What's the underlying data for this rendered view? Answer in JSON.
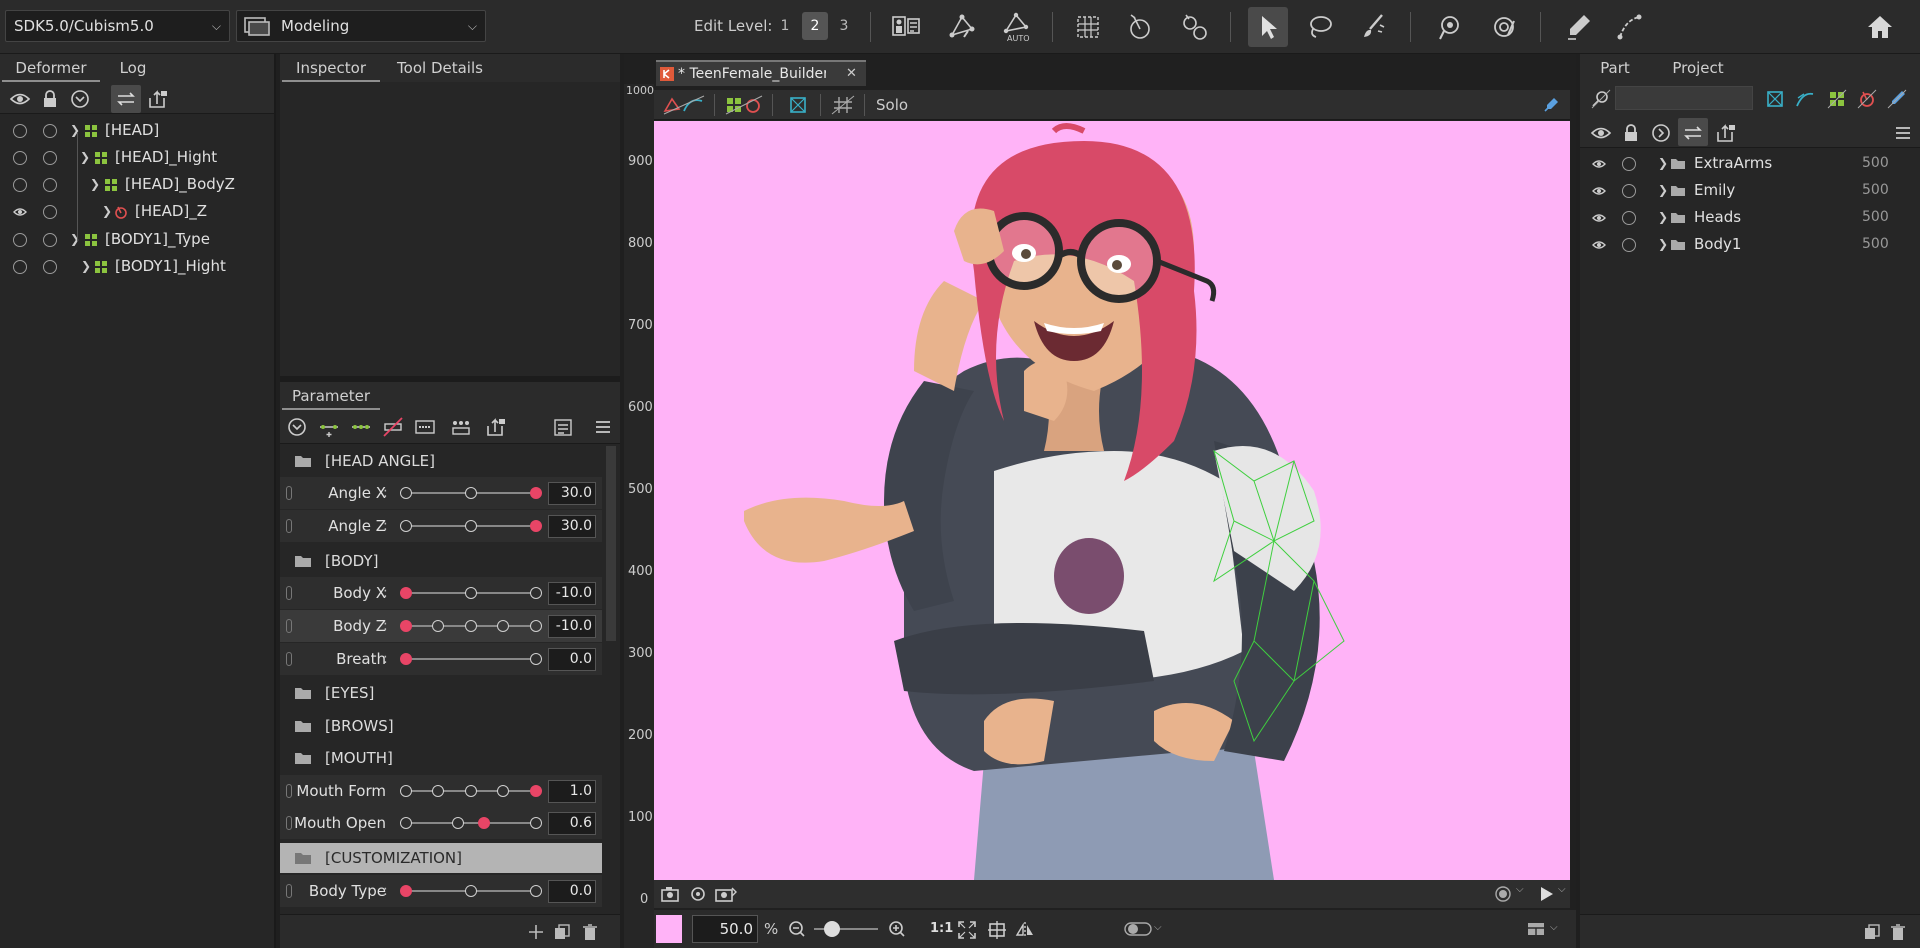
{
  "toolbar": {
    "sdk_select": "SDK5.0/Cubism5.0",
    "mode_select": "Modeling",
    "edit_level_label": "Edit Level:",
    "edit_levels": [
      "1",
      "2",
      "3"
    ],
    "auto_label": "AUTO"
  },
  "left_panel": {
    "tabs": [
      "Deformer",
      "Log"
    ],
    "tree": [
      {
        "label": "[HEAD]",
        "eye": false
      },
      {
        "label": "[HEAD]_Hight",
        "eye": false
      },
      {
        "label": "[HEAD]_BodyZ",
        "eye": false
      },
      {
        "label": "[HEAD]_Z",
        "eye": true
      },
      {
        "label": "[BODY1]_Type",
        "eye": false
      },
      {
        "label": "[BODY1]_Hight",
        "eye": false
      }
    ]
  },
  "inspector": {
    "tabs": [
      "Inspector",
      "Tool Details"
    ]
  },
  "parameter": {
    "tab": "Parameter",
    "groups": {
      "head_angle": "[HEAD ANGLE]",
      "body": "[BODY]",
      "eyes": "[EYES]",
      "brows": "[BROWS]",
      "mouth": "[MOUTH]",
      "customization": "[CUSTOMIZATION]"
    },
    "rows": {
      "angle_x": {
        "label": "Angle X",
        "value": "30.0"
      },
      "angle_z": {
        "label": "Angle Z",
        "value": "30.0"
      },
      "body_x": {
        "label": "Body X",
        "value": "-10.0"
      },
      "body_z": {
        "label": "Body Z",
        "value": "-10.0"
      },
      "breath": {
        "label": "Breath",
        "value": "0.0"
      },
      "mouth_form": {
        "label": "Mouth Form",
        "value": "1.0"
      },
      "mouth_open": {
        "label": "Mouth Open",
        "value": "0.6"
      },
      "body_type": {
        "label": "Body Type",
        "value": "0.0"
      }
    }
  },
  "canvas": {
    "doc_tab": "* TeenFemale_Builder_…",
    "solo_label": "Solo",
    "ruler": [
      "1000",
      "900",
      "800",
      "700",
      "600",
      "500",
      "400",
      "300",
      "200",
      "100",
      "0"
    ],
    "zoom_value": "50.0",
    "zoom_unit": "%",
    "ratio_label": "1:1",
    "bg_color": "#ffb3f7"
  },
  "right_panel": {
    "tabs": [
      "Part",
      "Project"
    ],
    "parts": [
      {
        "label": "ExtraArms",
        "value": "500"
      },
      {
        "label": "Emily",
        "value": "500"
      },
      {
        "label": "Heads",
        "value": "500"
      },
      {
        "label": "Body1",
        "value": "500"
      }
    ]
  }
}
